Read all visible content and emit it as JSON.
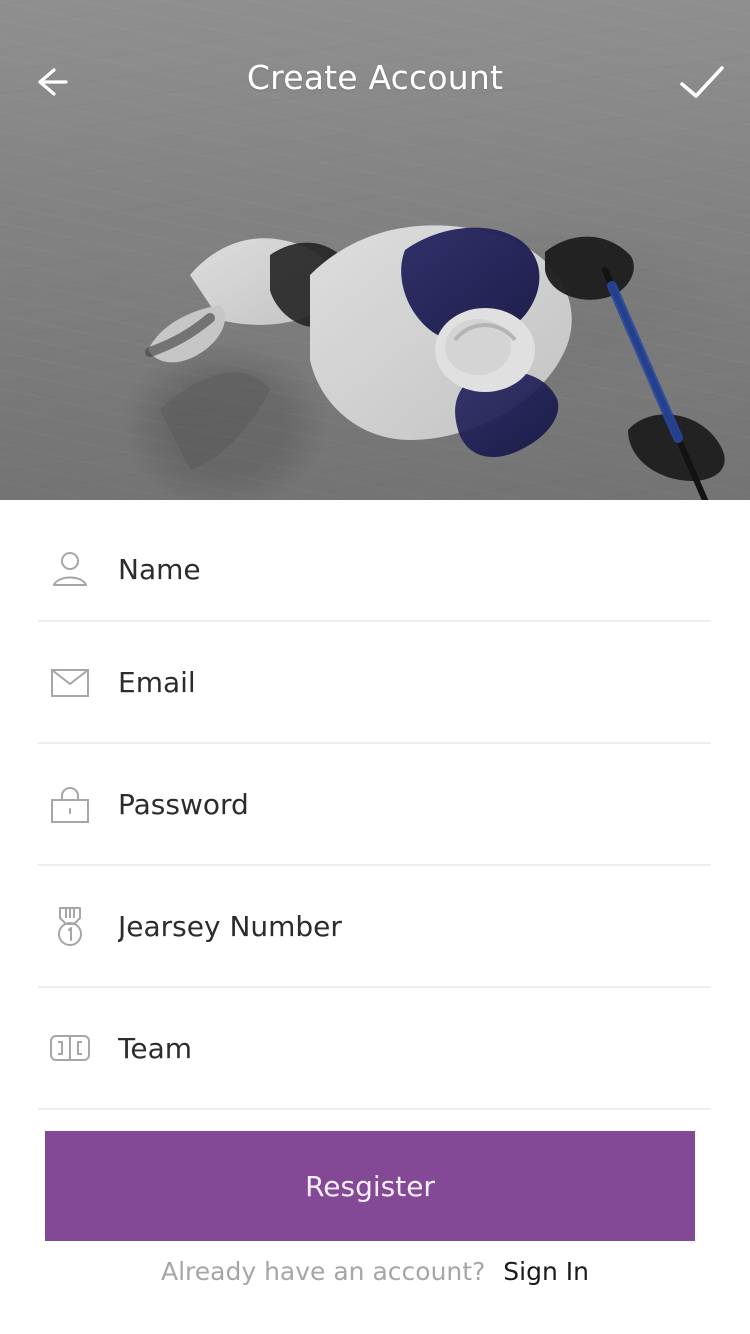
{
  "header": {
    "title": "Create Account",
    "back_icon": "back-arrow-icon",
    "done_icon": "checkmark-icon"
  },
  "hero": {
    "image_alt": "Hockey player photo"
  },
  "form": {
    "fields": [
      {
        "name": "name",
        "placeholder": "Name",
        "icon": "person-icon"
      },
      {
        "name": "email",
        "placeholder": "Email",
        "icon": "mail-icon"
      },
      {
        "name": "password",
        "placeholder": "Password",
        "icon": "lock-icon"
      },
      {
        "name": "jersey",
        "placeholder": "Jearsey Number",
        "icon": "medal-icon"
      },
      {
        "name": "team",
        "placeholder": "Team",
        "icon": "rink-icon"
      }
    ]
  },
  "actions": {
    "register_label": "Resgister",
    "signin_prompt": "Already have an account?",
    "signin_link": "Sign In"
  },
  "colors": {
    "accent": "#834996",
    "divider": "#ededed",
    "icon_gray": "#a6a6a6"
  }
}
